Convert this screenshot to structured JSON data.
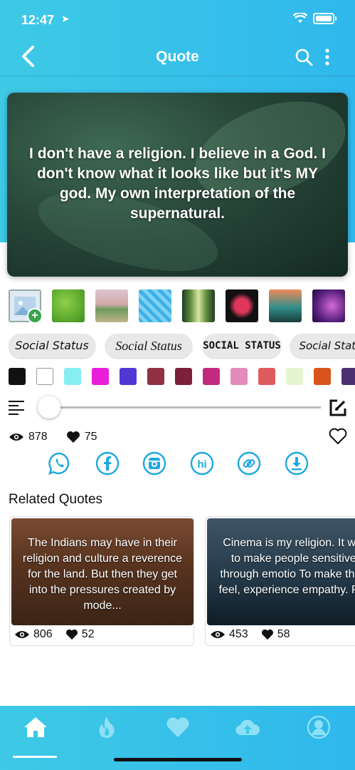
{
  "status_bar": {
    "time": "12:47"
  },
  "header": {
    "title": "Quote"
  },
  "quote_card": {
    "text": "I don't have a religion. I believe in a God. I don't know what it looks like but it's MY god. My own interpretation of the supernatural."
  },
  "font_chips": [
    "Social Status",
    "Social Status",
    "SOCIAL STATUS",
    "Social Status"
  ],
  "colors": [
    "#111111",
    "#ffffff",
    "#86eef2",
    "#e81ed8",
    "#5038d6",
    "#8f3045",
    "#7a1f3c",
    "#c22a80",
    "#e38cbc",
    "#dd5b5d",
    "#e4f5cf",
    "#d9541c",
    "#4a3070"
  ],
  "stats": {
    "views": "878",
    "likes": "75"
  },
  "section_title": "Related Quotes",
  "related": [
    {
      "text": "The Indians may have in their religion and culture a reverence for the land. But then they get into the pressures created by mode...",
      "views": "806",
      "likes": "52"
    },
    {
      "text": "Cinema is my religion. It way to make people sensitive, through emotio To make them feel, experience empathy. Peo",
      "views": "453",
      "likes": "58"
    }
  ],
  "icons": {
    "nav": [
      "back-icon",
      "search-icon",
      "more-icon"
    ],
    "share": [
      "whatsapp-icon",
      "facebook-icon",
      "instagram-icon",
      "hike-icon",
      "link-icon",
      "download-icon"
    ],
    "tabs": [
      "home-icon",
      "trending-icon",
      "favorites-icon",
      "upload-icon",
      "profile-icon"
    ]
  }
}
